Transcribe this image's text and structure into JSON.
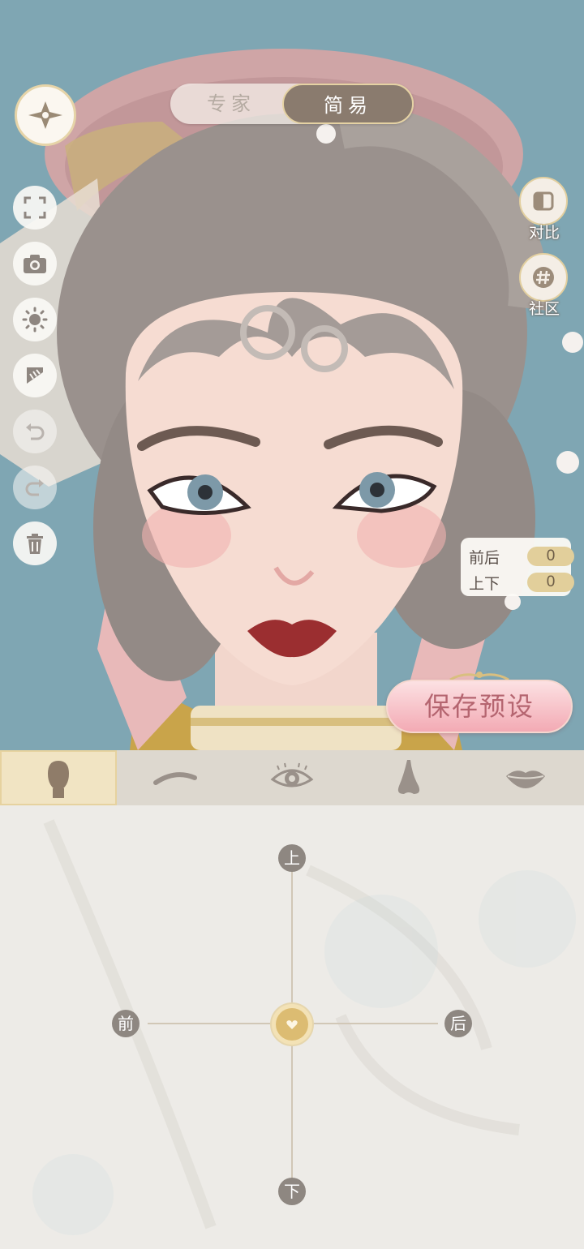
{
  "mode_toggle": {
    "expert_label": "专家",
    "simple_label": "简易",
    "selected": "简易"
  },
  "left_toolbar": {
    "icons": [
      "back-star-icon",
      "fullscreen-icon",
      "camera-icon",
      "sun-icon",
      "comb-icon",
      "undo-icon",
      "redo-icon",
      "trash-icon"
    ]
  },
  "right_buttons": {
    "compare_label": "对比",
    "community_label": "社区"
  },
  "position_readout": {
    "front_back_label": "前后",
    "front_back_value": "0",
    "up_down_label": "上下",
    "up_down_value": "0"
  },
  "save_button_label": "保存预设",
  "category_tabs": [
    {
      "name": "face",
      "icon": "face-silhouette-icon",
      "active": true
    },
    {
      "name": "eyebrow",
      "icon": "eyebrow-icon",
      "active": false
    },
    {
      "name": "eye",
      "icon": "eye-icon",
      "active": false
    },
    {
      "name": "nose",
      "icon": "nose-icon",
      "active": false
    },
    {
      "name": "lips",
      "icon": "lips-icon",
      "active": false
    }
  ],
  "joystick": {
    "up_label": "上",
    "down_label": "下",
    "front_label": "前",
    "back_label": "后"
  },
  "colors": {
    "accent_gold": "#e2cf9b",
    "save_pink": "#f3aab4",
    "mode_selected": "#8a7b6e",
    "viewport_bg": "#7fa6b3"
  }
}
